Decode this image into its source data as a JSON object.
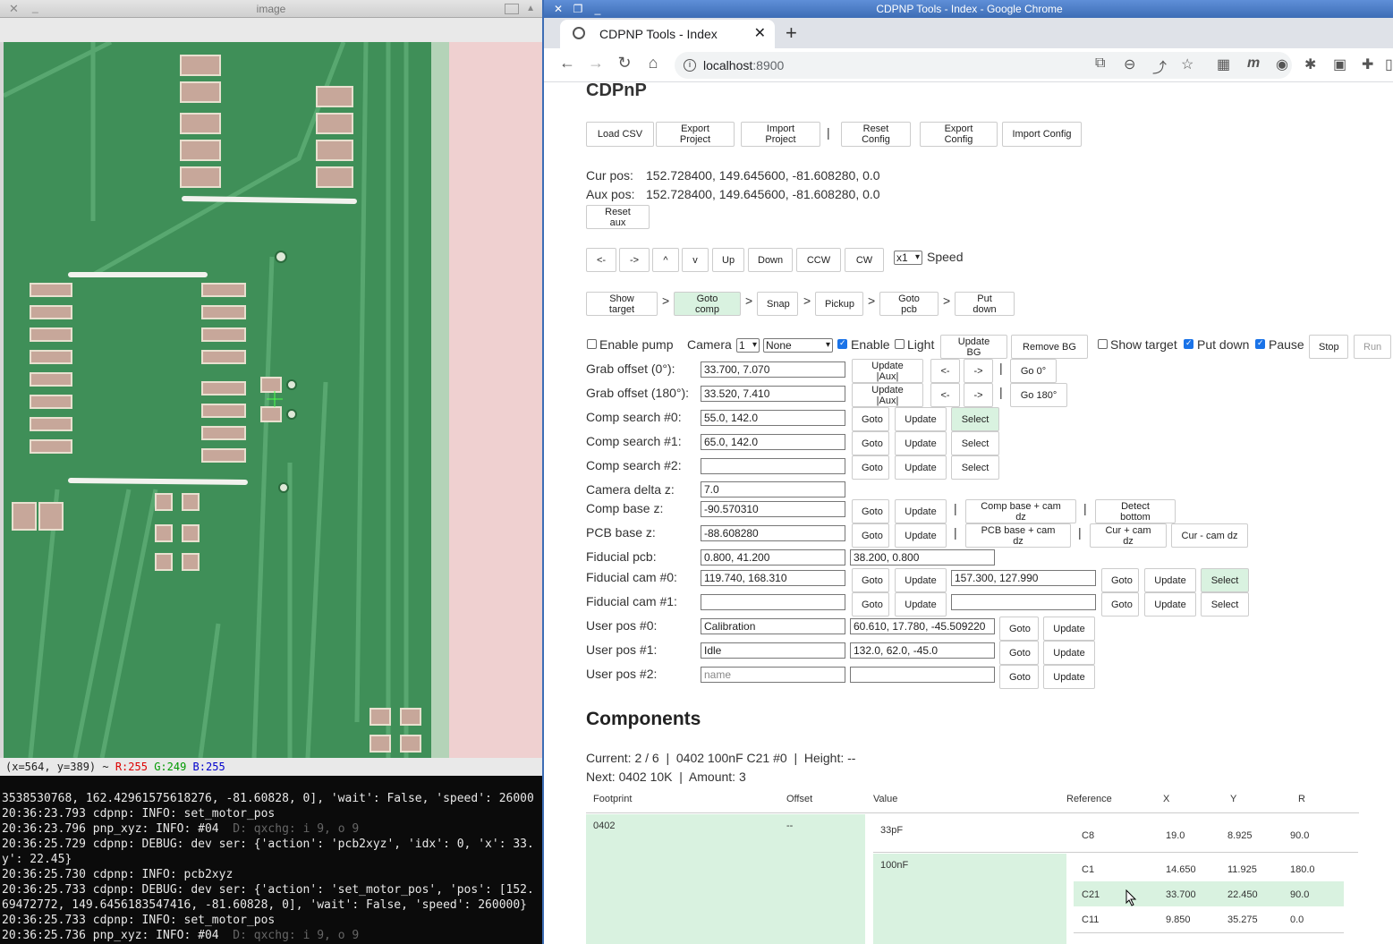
{
  "left_window": {
    "title": "image",
    "close_glyph": "✕",
    "min_glyph": "_",
    "pixel_status": {
      "coord": "(x=564, y=389) ~ ",
      "r": "R:255",
      "g": "G:249",
      "b": "B:255"
    }
  },
  "terminal": {
    "lines": [
      "3538530768, 162.42961575618276, -81.60828, 0], 'wait': False, 'speed': 26000",
      "20:36:23.793 cdpnp: INFO: set_motor_pos",
      "20:36:23.796 pnp_xyz: INFO: #04",
      "20:36:25.729 cdpnp: DEBUG: dev ser: {'action': 'pcb2xyz', 'idx': 0, 'x': 33.",
      "y': 22.45}",
      "20:36:25.730 cdpnp: INFO: pcb2xyz",
      "20:36:25.733 cdpnp: DEBUG: dev ser: {'action': 'set_motor_pos', 'pos': [152.",
      "69472772, 149.6456183547416, -81.60828, 0], 'wait': False, 'speed': 260000}",
      "20:36:25.733 cdpnp: INFO: set_motor_pos",
      "20:36:25.736 pnp_xyz: INFO: #04"
    ],
    "overlay_a": "D: qxchg: i 9, o 9",
    "overlay_b": "D: qxchg: i 9, o 9"
  },
  "browser": {
    "window_title": "CDPNP Tools - Index - Google Chrome",
    "tab_title": "CDPNP Tools - Index",
    "url_host": "localhost",
    "url_port": ":8900"
  },
  "app": {
    "title": "CDPnP",
    "toolbar": [
      "Load CSV",
      "Export Project",
      "Import Project",
      "Reset Config",
      "Export Config",
      "Import Config"
    ],
    "cur_pos_label": "Cur pos:",
    "cur_pos": "152.728400, 149.645600, -81.608280, 0.0",
    "aux_pos_label": "Aux pos:",
    "aux_pos": "152.728400, 149.645600, -81.608280, 0.0",
    "reset_aux": "Reset aux",
    "jog": [
      "<-",
      "->",
      "^",
      "v",
      "Up",
      "Down",
      "CCW",
      "CW"
    ],
    "speed_value": "x1",
    "speed_label": "Speed",
    "flow": [
      "Show target",
      "Goto comp",
      "Snap",
      "Pickup",
      "Goto pcb",
      "Put down"
    ],
    "enable_pump": "Enable pump",
    "camera_label": "Camera",
    "camera_value": "1",
    "camera_mode": "None",
    "enable": "Enable",
    "light": "Light",
    "update_bg": "Update BG",
    "remove_bg": "Remove BG",
    "show_target": "Show target",
    "put_down": "Put down",
    "pause": "Pause",
    "stop": "Stop",
    "run": "Run",
    "grab0_label": "Grab offset (0°):",
    "grab0_value": "33.700, 7.070",
    "grab180_label": "Grab offset (180°):",
    "grab180_value": "33.520, 7.410",
    "update_aux": "Update |Aux|",
    "go0": "Go 0°",
    "go180": "Go 180°",
    "goto": "Goto",
    "update": "Update",
    "select": "Select",
    "comp_search0_label": "Comp search #0:",
    "comp_search0": "55.0, 142.0",
    "comp_search1_label": "Comp search #1:",
    "comp_search1": "65.0, 142.0",
    "comp_search2_label": "Comp search #2:",
    "comp_search2": "",
    "cam_dz_label": "Camera delta z:",
    "cam_dz": "7.0",
    "comp_base_label": "Comp base z:",
    "comp_base": "-90.570310",
    "comp_base_cam": "Comp base + cam dz",
    "detect_bottom": "Detect bottom",
    "pcb_base_label": "PCB base z:",
    "pcb_base": "-88.608280",
    "pcb_base_cam": "PCB base + cam dz",
    "cur_plus": "Cur + cam dz",
    "cur_minus": "Cur - cam dz",
    "fid_pcb_label": "Fiducial pcb:",
    "fid_pcb_a": "0.800, 41.200",
    "fid_pcb_b": "38.200, 0.800",
    "fid_cam0_label": "Fiducial cam #0:",
    "fid_cam0_a": "119.740, 168.310",
    "fid_cam0_b": "157.300, 127.990",
    "fid_cam1_label": "Fiducial cam #1:",
    "user0_label": "User pos #0:",
    "user0_name": "Calibration",
    "user0_pos": "60.610, 17.780, -45.509220",
    "user1_label": "User pos #1:",
    "user1_name": "Idle",
    "user1_pos": "132.0, 62.0, -45.0",
    "user2_label": "User pos #2:",
    "name_placeholder": "name",
    "pipe": "|",
    "gt": ">"
  },
  "components": {
    "heading": "Components",
    "current": "Current: 2 / 6  |  0402 100nF C21 #0  |  Height: --",
    "next": "Next: 0402 10K  |  Amount: 3",
    "headers": [
      "Footprint",
      "Offset",
      "Value",
      "Reference",
      "X",
      "Y",
      "R"
    ],
    "footprint": "0402",
    "offset": "--",
    "values": [
      "33pF",
      "100nF"
    ],
    "rows": [
      {
        "ref": "C8",
        "x": "19.0",
        "y": "8.925",
        "r": "90.0"
      },
      {
        "ref": "C1",
        "x": "14.650",
        "y": "11.925",
        "r": "180.0"
      },
      {
        "ref": "C21",
        "x": "33.700",
        "y": "22.450",
        "r": "90.0"
      },
      {
        "ref": "C11",
        "x": "9.850",
        "y": "35.275",
        "r": "0.0"
      }
    ]
  }
}
